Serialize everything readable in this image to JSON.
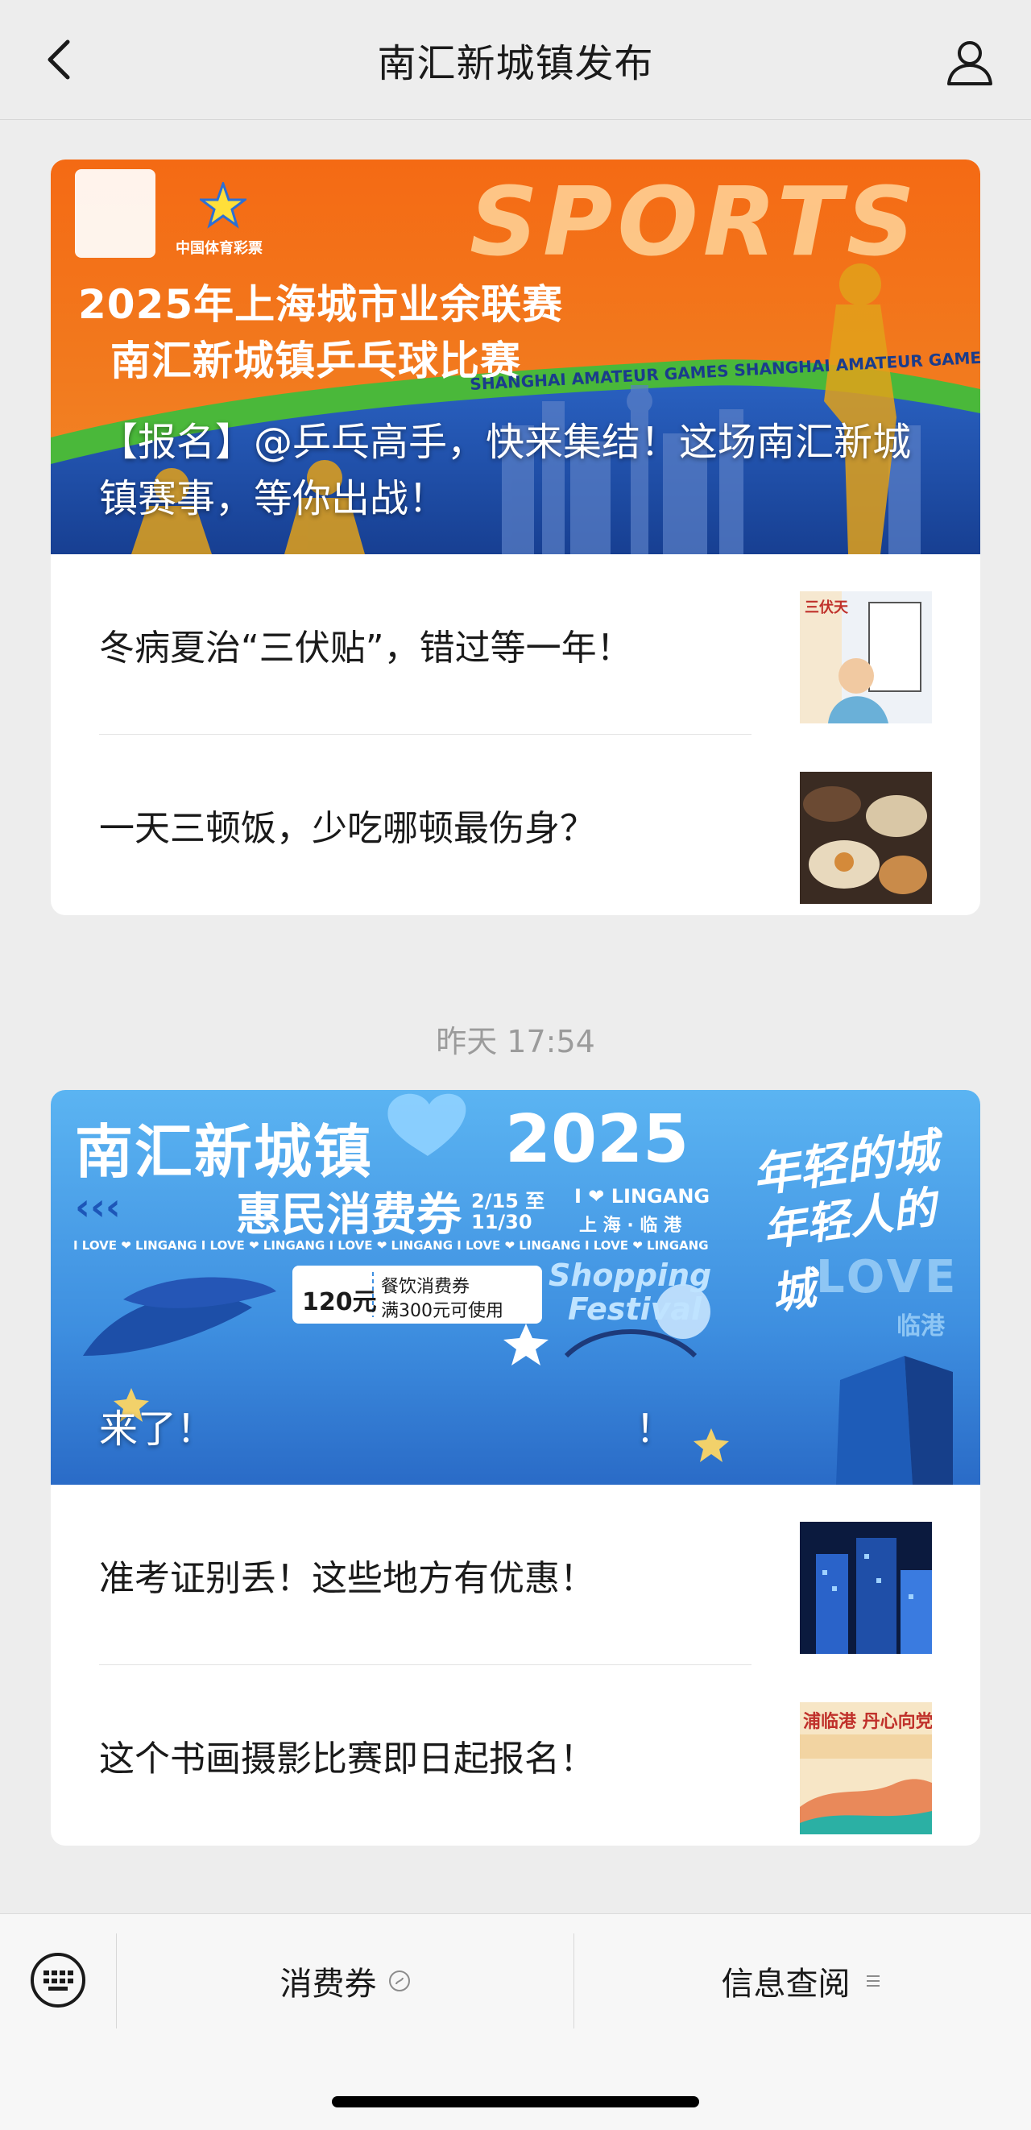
{
  "header": {
    "title": "南汇新城镇发布",
    "back_icon": "chevron-left-icon",
    "profile_icon": "person-icon"
  },
  "messages": [
    {
      "hero": {
        "title": "【报名】@乒乓高手，快来集结！这场南汇新城镇赛事，等你出战！",
        "banner_heading_1": "2025年上海城市业余联赛",
        "banner_heading_2": "南汇新城镇乒乓球比赛",
        "banner_sports": "SPORTS",
        "banner_logo_text": "中国体育彩票",
        "banner_ribbon": "SHANGHAI AMATEUR GAMES  SHANGHAI AMATEUR GAMES"
      },
      "articles": [
        {
          "title": "冬病夏治“三伏贴”，错过等一年！",
          "thumb_text": "三伏天"
        },
        {
          "title": "一天三顿饭，少吃哪顿最伤身？",
          "thumb_text": ""
        }
      ]
    },
    {
      "timestamp": "昨天 17:54",
      "hero": {
        "title": "来了！",
        "title_tail": "！",
        "banner_heading": "南汇新城镇",
        "banner_year": "2025",
        "banner_sub": "惠民消费券",
        "banner_date_1": "2/15 至",
        "banner_date_2": "11/30",
        "banner_lingang": "I ❤ LINGANG",
        "banner_city": "上 海 · 临 港",
        "banner_slogan_1": "年轻的城",
        "banner_slogan_2": "年轻人的城",
        "banner_love": "I LOVE ❤ LINGANG   I LOVE ❤ LINGANG   I LOVE ❤ LINGANG   I LOVE ❤ LINGANG   I LOVE ❤ LINGANG",
        "coupon_amount": "120元",
        "coupon_line1": "餐饮消费券",
        "coupon_line2": "满300元可使用",
        "festival_1": "Shopping",
        "festival_2": "Festival",
        "love_big": "LOVE",
        "love_sub": "临港"
      },
      "articles": [
        {
          "title": "准考证别丢！这些地方有优惠！",
          "thumb_text": ""
        },
        {
          "title": "这个书画摄影比赛即日起报名！",
          "thumb_text": "浦临港 丹心向党"
        }
      ]
    }
  ],
  "menu": {
    "keyboard_icon": "keyboard-icon",
    "item1": "消费券",
    "item1_icon": "mini-program-icon",
    "item2": "信息查阅",
    "item2_icon": "menu-lines-icon"
  },
  "colors": {
    "background": "#ededed",
    "banner1_orange": "#f26b1d",
    "banner1_blue": "#1c4aa8",
    "banner2_blue": "#3b8fe0"
  }
}
